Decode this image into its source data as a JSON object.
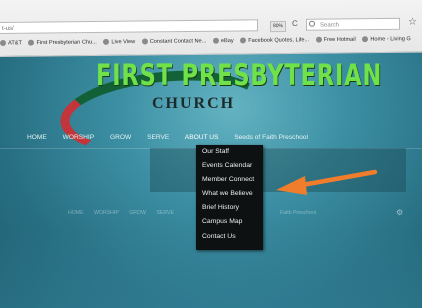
{
  "browser": {
    "url": "t-us/",
    "zoom": "80%",
    "search_placeholder": "Search",
    "bookmarks": [
      "AT&T",
      "First Presbyterian Chu...",
      "Live View",
      "Constant Contact Ne...",
      "eBay",
      "Facebook Quotes, Life...",
      "Free Hotmail",
      "Home - Living G"
    ]
  },
  "header": {
    "title_line1": "FIRST PRESBYTERIAN",
    "title_line2": "CHURCH"
  },
  "nav": {
    "items": [
      "HOME",
      "WORSHIP",
      "GROW",
      "SERVE",
      "ABOUT US"
    ],
    "extra": "Seeds of Faith Preschool"
  },
  "dropdown": {
    "items": [
      "Our Staff",
      "Events Calendar",
      "Member Connect",
      "What we Believe",
      "Brief History",
      "Campus Map",
      "Contact Us"
    ]
  },
  "ghost_nav": {
    "items": [
      "HOME",
      "WORSHIP",
      "GROW",
      "SERVE"
    ],
    "extra": "Faith Preschool"
  },
  "colors": {
    "arrow": "#f07d2c",
    "page_background": "#3c8fa3",
    "dropdown_background": "#0d1112",
    "logo_green": "#6fe24a"
  },
  "icons": [
    "search-icon",
    "reload-icon",
    "star-icon",
    "favicon-icon",
    "gear-icon"
  ]
}
